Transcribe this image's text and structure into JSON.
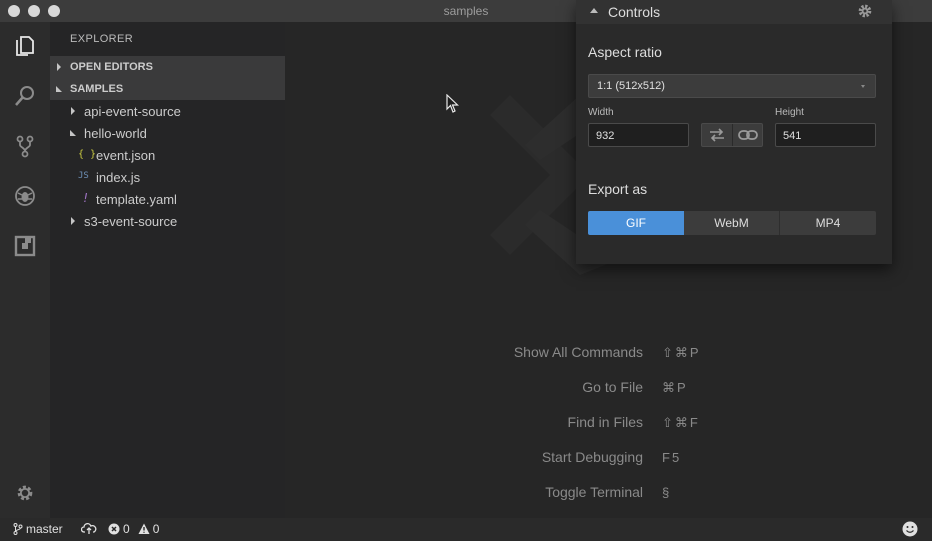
{
  "window": {
    "title": "samples"
  },
  "activity_bar": {
    "icons": [
      "files-icon",
      "search-icon",
      "source-control-icon",
      "debug-icon",
      "extensions-icon",
      "gear-icon"
    ]
  },
  "sidebar": {
    "title": "EXPLORER",
    "sections": [
      {
        "label": "OPEN EDITORS"
      },
      {
        "label": "SAMPLES"
      }
    ],
    "tree": [
      {
        "label": "api-event-source",
        "kind": "folder",
        "expanded": false
      },
      {
        "label": "hello-world",
        "kind": "folder",
        "expanded": true
      },
      {
        "label": "event.json",
        "kind": "file",
        "icon": "{ }"
      },
      {
        "label": "index.js",
        "kind": "file",
        "icon": "JS"
      },
      {
        "label": "template.yaml",
        "kind": "file",
        "icon": "!"
      },
      {
        "label": "s3-event-source",
        "kind": "folder",
        "expanded": false
      }
    ]
  },
  "controls": {
    "title": "Controls",
    "aspect_ratio_label": "Aspect ratio",
    "aspect_ratio_value": "1:1 (512x512)",
    "width_label": "Width",
    "width_value": "932",
    "height_label": "Height",
    "height_value": "541",
    "export_label": "Export as",
    "formats": [
      "GIF",
      "WebM",
      "MP4"
    ],
    "selected_format": "GIF"
  },
  "commands": [
    {
      "name": "Show All Commands",
      "key": "⇧⌘P"
    },
    {
      "name": "Go to File",
      "key": "⌘P"
    },
    {
      "name": "Find in Files",
      "key": "⇧⌘F"
    },
    {
      "name": "Start Debugging",
      "key": "F5"
    },
    {
      "name": "Toggle Terminal",
      "key": "§"
    }
  ],
  "status_bar": {
    "branch": "master",
    "errors": "0",
    "warnings": "0"
  },
  "colors": {
    "accent": "#4a90d9",
    "activity_bar": "#2c2c2c",
    "sidebar": "#252526",
    "editor": "#262626"
  }
}
